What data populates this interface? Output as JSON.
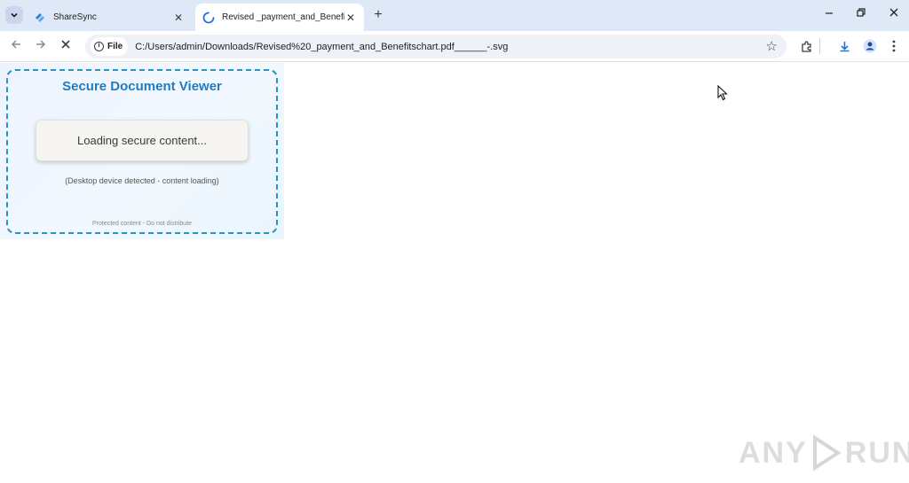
{
  "tabs": [
    {
      "title": "ShareSync",
      "icon": "sharesync-logo-icon",
      "active": false
    },
    {
      "title": "Revised _payment_and_Benefits",
      "icon": "loading-spinner-icon",
      "active": true
    }
  ],
  "toolbar": {
    "chip_label": "File",
    "url": "C:/Users/admin/Downloads/Revised%20_payment_and_Benefitschart.pdf______-.svg"
  },
  "viewer": {
    "title": "Secure Document Viewer",
    "loading_text": "Loading secure content...",
    "device_note": "(Desktop device detected - content loading)",
    "protected_note": "Protected content - Do not distribute",
    "accent_color": "#1f7cc0",
    "border_color": "#2a93c6"
  },
  "watermark": {
    "left": "ANY",
    "right": "RUN"
  }
}
